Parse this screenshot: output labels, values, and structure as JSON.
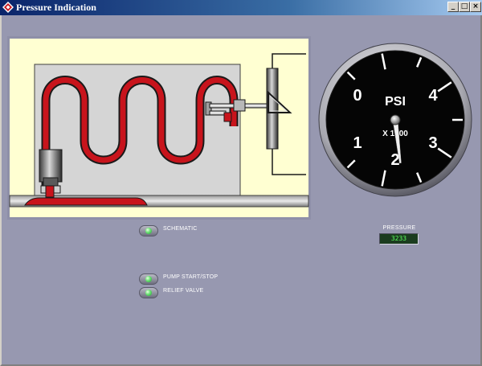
{
  "window": {
    "title": "Pressure Indication",
    "controls": {
      "minimize": "_",
      "maximize": "□",
      "close": "×"
    }
  },
  "gauge": {
    "unit_label": "PSI",
    "multiplier_label": "X 1000",
    "dial_labels": [
      "0",
      "1",
      "2",
      "3",
      "4"
    ],
    "needle_value": 3233,
    "face_color": "#050505"
  },
  "pressure": {
    "label": "PRESSURE",
    "value": "3233"
  },
  "toggles": [
    {
      "label": "SCHEMATIC"
    },
    {
      "label": "PUMP START/STOP"
    },
    {
      "label": "RELIEF VALVE"
    }
  ],
  "colors": {
    "background": "#9798B0",
    "fluid": "#C8141C",
    "schematic_bg": "#FFFFD2",
    "tank": "#D5D5D5",
    "indicator_green": "#5CFF60"
  }
}
